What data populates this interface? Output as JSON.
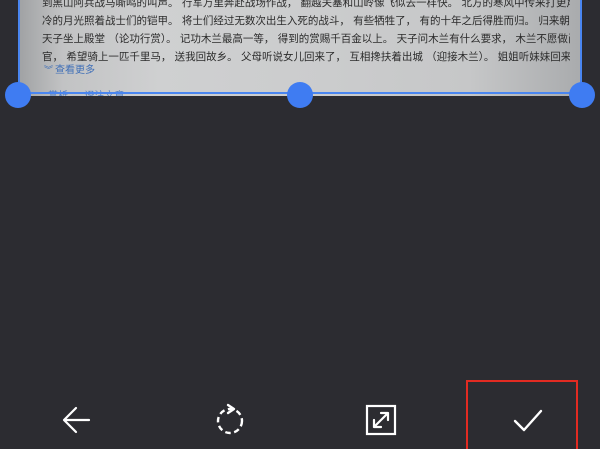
{
  "photo": {
    "lines": [
      "到黑山阿兵战马嘶鸣的叫声。 行军万里奔赴战场作战， 翻越关塞和山岭像飞似去一样快。 北方的寒风中传来打更声， 寒",
      "冷的月光照着战士们的铠甲。 将士们经过无数次出生入死的战斗， 有些牺牲了， 有的十年之后得胜而归。 归来朝见天子，",
      "天子坐上殿堂 （论功行赏）。 记功木兰最高一等， 得到的赏赐千百金以上。 天子问木兰有什么要求， 木兰不愿做尚书省的",
      "官， 希望骑上一匹千里马， 送我回故乡。 父母听说女儿回来了， 互相搀扶着出城 （迎接木兰）。 姐姐听妹妹回来了， 对门"
    ],
    "view_more": "查看更多",
    "link_text": "赏析 — 译注文章"
  },
  "toolbar": {
    "back_icon": "arrow-left-icon",
    "rotate_icon": "rotate-icon",
    "expand_icon": "expand-icon",
    "confirm_icon": "checkmark-icon"
  },
  "colors": {
    "background": "#2c2c31",
    "crop_accent": "#3f7cf2",
    "highlight": "#e22b22",
    "icon": "#ffffff"
  }
}
